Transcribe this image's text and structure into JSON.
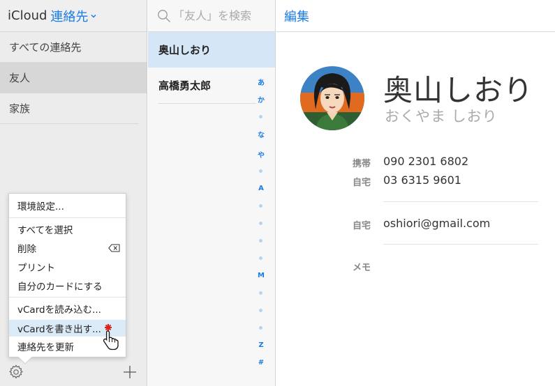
{
  "groups": {
    "app_name": "iCloud",
    "section_title": "連絡先",
    "items": [
      {
        "label": "すべての連絡先"
      },
      {
        "label": "友人"
      },
      {
        "label": "家族"
      }
    ]
  },
  "menu": {
    "items": [
      {
        "label": "環境設定..."
      },
      {
        "label": "すべてを選択"
      },
      {
        "label": "削除"
      },
      {
        "label": "プリント"
      },
      {
        "label": "自分のカードにする"
      },
      {
        "label": "vCardを読み込む..."
      },
      {
        "label": "vCardを書き出す..."
      },
      {
        "label": "連絡先を更新"
      }
    ]
  },
  "list": {
    "search_placeholder": "「友人」を検索",
    "contacts": [
      {
        "name": "奥山しおり"
      },
      {
        "name": "高橋勇太郎"
      }
    ],
    "index_letters": [
      "あ",
      "か",
      "な",
      "や",
      "A",
      "M",
      "Z",
      "#"
    ]
  },
  "detail": {
    "edit_label": "編集",
    "name": "奥山しおり",
    "reading": "おくやま しおり",
    "fields": [
      {
        "label": "携帯",
        "value": "090 2301 6802"
      },
      {
        "label": "自宅",
        "value": "03 6315 9601"
      },
      {
        "label": "自宅",
        "value": "oshiori@gmail.com"
      },
      {
        "label": "メモ",
        "value": ""
      }
    ]
  },
  "colors": {
    "accent": "#1a7ce6",
    "selected_contact_bg": "#d5e7f7",
    "selected_group_bg": "#d7d7d7",
    "highlight_menu_bg": "#dbeaf7"
  },
  "icons": [
    "chevron-down-icon",
    "search-icon",
    "gear-icon",
    "plus-icon",
    "delete-icon",
    "hand-cursor-icon"
  ]
}
